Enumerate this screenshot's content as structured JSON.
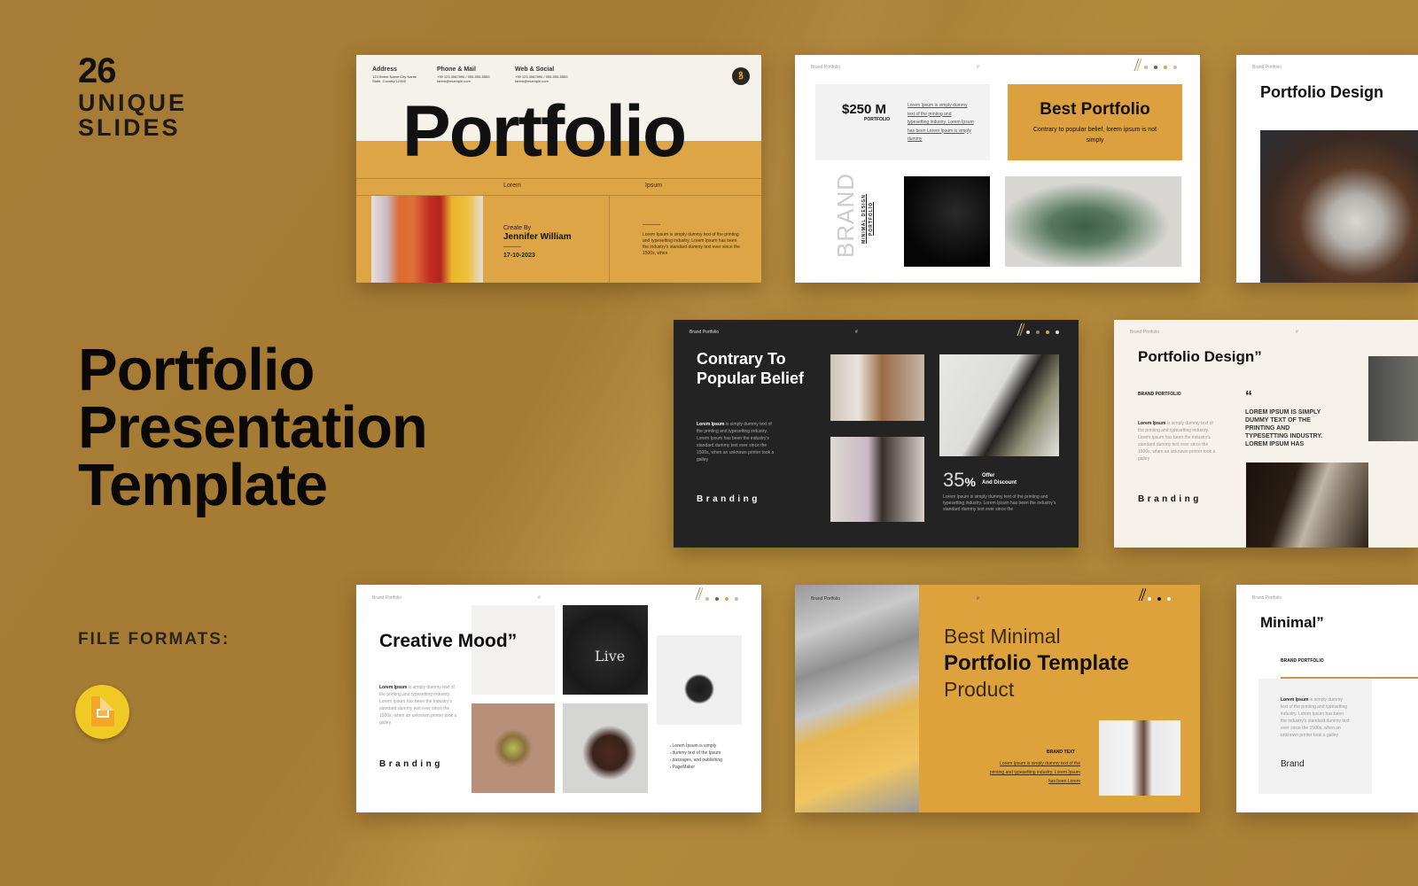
{
  "promo": {
    "slide_count": "26",
    "slide_count_label": "UNIQUE SLIDES",
    "title": [
      "Portfolio",
      "Presentation",
      "Template"
    ],
    "file_formats_label": "FILE FORMATS:",
    "format_icon": "google-slides-icon"
  },
  "colors": {
    "background": "#a77d37",
    "accent": "#dda545",
    "dark_slide": "#232323",
    "text": "#111111"
  },
  "slides": {
    "cover": {
      "address_label": "Address",
      "address_value": "123 Street Name City Name State, Country 12345",
      "phone_label": "Phone & Mail",
      "phone_value": "+00 123 4567890 / 555-555-5555 lorem@example.com",
      "web_label": "Web & Social",
      "web_value": "+00 123 4567890 / 555-555-5555 lorem@example.com",
      "logo_glyph": "ꝸ",
      "title": "Portfolio",
      "col_left": "Lorem",
      "col_right": "Ipsum",
      "create_by": "Create By",
      "author": "Jennifer William",
      "date": "17-10-2023",
      "body": "Lorem Ipsum is simply dummy text of the printing and typesetting industry. Lorem Ipsum has been the industry's standard dummy text ever since the 1500s, when"
    },
    "best_portfolio": {
      "header": "Brand Portfolio",
      "page": "#",
      "amount": "$250 M",
      "amount_label": "PORTFOLIO",
      "amount_text": "Lorem Ipsum is simply dummy text of the printing and typesetting industry. Lorem Ipsum has been Lorem Ipsum is simply dummy",
      "title": "Best Portfolio",
      "subtitle": "Contrary to popular belief, lorem ipsum is not simply",
      "brand_word": "BRAND",
      "brand_sub": "MINIMAL DESIGN PORTFOLIO"
    },
    "portfolio_design_horses": {
      "header": "Brand Portfolio",
      "title": "Portfolio Design"
    },
    "contrary": {
      "header": "Brand Portfolio",
      "page": "#",
      "title": "Contrary To Popular Belief",
      "body_bold": "Lorem Ipsum",
      "body": " is simply dummy text of the printing and typesetting industry. Lorem Ipsum has been the industry's standard dummy text ever since the 1500s, when an unknown printer took a galley",
      "branding": "Branding",
      "percent": "35",
      "percent_sign": "%",
      "offer": "Offer",
      "offer_sub": "And Discount",
      "offer_body": "Lorem Ipsum is simply dummy text of the printing and typesetting industry. Lorem Ipsum has been the industry's standard dummy text ever since the"
    },
    "portfolio_design_quote": {
      "header": "Brand Portfolio",
      "page": "#",
      "title": "Portfolio Design”",
      "label": "BRAND PORTFOLIO",
      "body_bold": "Lorem Ipsum",
      "body": " is simply dummy text of the printing and typesetting industry. Lorem Ipsum has been the industry's standard dummy text ever since the 1500s, when an unknown printer took a galley",
      "quote_mark": "“",
      "quote": "LOREM IPSUM IS SIMPLY DUMMY TEXT OF THE PRINTING AND TYPESETTING INDUSTRY. LOREM IPSUM HAS",
      "branding": "Branding"
    },
    "creative_mood": {
      "header": "Brand Portfolio",
      "page": "#",
      "title": "Creative Mood”",
      "body_bold": "Lorem Ipsum",
      "body": " is simply dummy text of the printing and typesetting industry. Lorem Ipsum has been the industry's standard dummy text ever since the 1500s, when an unknown printer took a galley",
      "branding": "Branding",
      "pillow_text": "Live",
      "bullets": [
        "Lorem Ipsum is simply",
        "dummy text of the Ipsum",
        "passages, and publishing",
        "PageMaker"
      ]
    },
    "best_minimal": {
      "header": "Brand Portfolio",
      "page": "#",
      "line1": "Best Minimal",
      "line2": "Portfolio Template",
      "line3": "Product",
      "brand_text": "BRAND TEXT",
      "body": "Lorem Ipsum is simply dummy text of the printing and typesetting industry. Lorem Ipsum has been Lorem"
    },
    "minimal": {
      "header": "Brand Portfolio",
      "title": "Minimal”",
      "label": "BRAND PORTFOLIO",
      "body_bold": "Lorem Ipsum",
      "body": " is simply dummy text of the printing and typesetting industry. Lorem Ipsum has been the industry's standard dummy text ever since the 1500s, when an unknown printer took a galley",
      "brand": "Brand"
    }
  }
}
